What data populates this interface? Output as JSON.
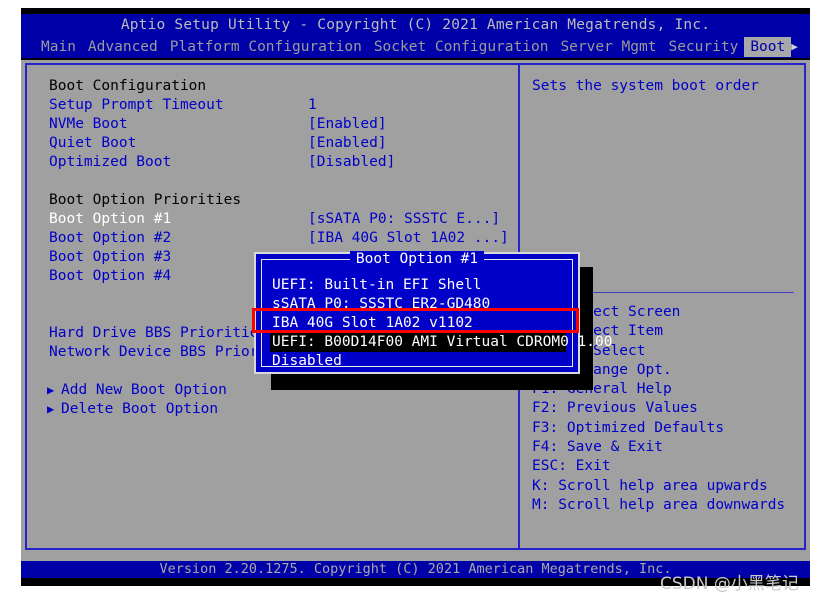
{
  "header": {
    "title": "Aptio Setup Utility - Copyright (C) 2021 American Megatrends, Inc.",
    "tabs": [
      {
        "label": "Main",
        "active": false
      },
      {
        "label": "Advanced",
        "active": false
      },
      {
        "label": "Platform Configuration",
        "active": false
      },
      {
        "label": "Socket Configuration",
        "active": false
      },
      {
        "label": "Server Mgmt",
        "active": false
      },
      {
        "label": "Security",
        "active": false
      },
      {
        "label": "Boot",
        "active": true
      }
    ],
    "more_arrow": "▶"
  },
  "main": {
    "section_boot_configuration": "Boot Configuration",
    "rows_config": [
      {
        "label": "Setup Prompt Timeout",
        "value": "1"
      },
      {
        "label": "NVMe Boot",
        "value": "[Enabled]"
      },
      {
        "label": "Quiet Boot",
        "value": "[Enabled]"
      },
      {
        "label": "Optimized Boot",
        "value": "[Disabled]"
      }
    ],
    "section_boot_option_priorities": "Boot Option Priorities",
    "rows_priorities": [
      {
        "label": "Boot Option #1",
        "value": "[sSATA  P0: SSSTC E...]",
        "selected": true
      },
      {
        "label": "Boot Option #2",
        "value": "[IBA 40G Slot 1A02 ...]",
        "selected": false
      },
      {
        "label": "Boot Option #3",
        "value": "",
        "selected": false
      },
      {
        "label": "Boot Option #4",
        "value": "",
        "selected": false
      }
    ],
    "rows_bbs": [
      {
        "label": "Hard Drive BBS Priorities"
      },
      {
        "label": "Network Device BBS Priorities"
      }
    ],
    "rows_actions": [
      {
        "label": "Add New Boot Option",
        "caret": "▶"
      },
      {
        "label": "Delete Boot Option",
        "caret": "▶"
      }
    ]
  },
  "help": {
    "description": "Sets the system boot order",
    "shortcuts": [
      "→←: Select Screen",
      "↑↓: Select Item",
      "Enter: Select",
      "+/-: Change Opt.",
      "F1: General Help",
      "F2: Previous Values",
      "F3: Optimized Defaults",
      "F4: Save & Exit",
      "ESC: Exit",
      "K: Scroll help area upwards",
      "M: Scroll help area downwards"
    ]
  },
  "dialog": {
    "title": "Boot Option #1",
    "options": [
      {
        "label": "UEFI: Built-in EFI Shell",
        "selected": false
      },
      {
        "label": "sSATA  P0: SSSTC ER2-GD480",
        "selected": false
      },
      {
        "label": "IBA 40G Slot 1A02 v1102",
        "selected": false
      },
      {
        "label": "UEFI: B00D14F00 AMI Virtual CDROM0 1.00",
        "selected": true
      },
      {
        "label": "Disabled",
        "selected": false
      }
    ]
  },
  "footer": {
    "version": "Version 2.20.1275. Copyright (C) 2021 American Megatrends, Inc."
  },
  "watermark": {
    "text": "CSDN @小黑笔记"
  },
  "colors": {
    "bios_blue": "#0000a8",
    "body_gray": "#a0a0a0",
    "text_blue": "#0000c8",
    "text_selected": "#ffffff",
    "annotation_red": "#ff0000",
    "dialog_blue": "#0000c8"
  }
}
